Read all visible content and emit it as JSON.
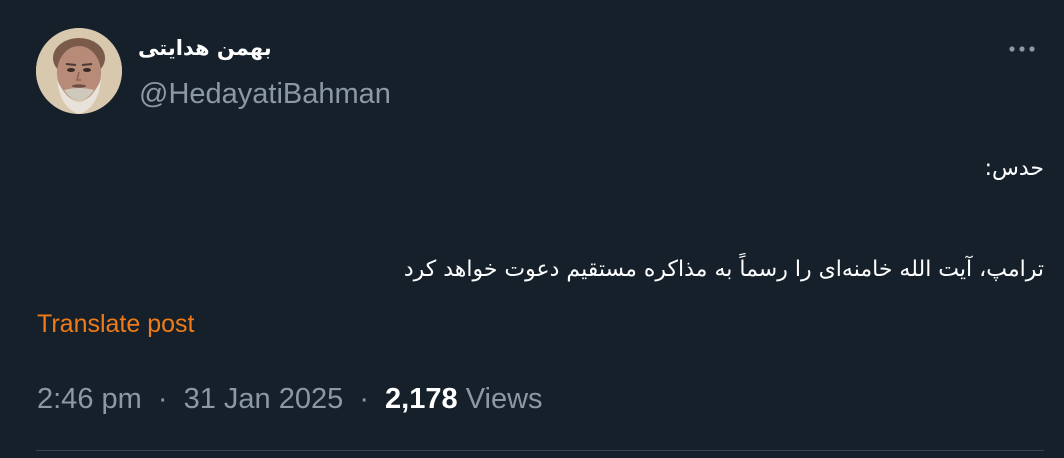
{
  "author": {
    "display_name": "بهمن هدایتی",
    "handle": "@HedayatiBahman"
  },
  "post": {
    "text_line1": "حدس:",
    "text_line2": "ترامپ، آیت الله خامنه‌ای را رسماً به مذاکره مستقیم دعوت خواهد کرد",
    "translate_label": "Translate post",
    "time": "2:46 pm",
    "date": "31 Jan 2025",
    "separator": "·",
    "views_count": "2,178",
    "views_label": "Views"
  },
  "icons": {
    "more": "more-horizontal-icon"
  },
  "colors": {
    "background": "#15202b",
    "secondary_text": "#8b98a5",
    "translate_link": "#f07b17",
    "divider": "#38444d"
  }
}
